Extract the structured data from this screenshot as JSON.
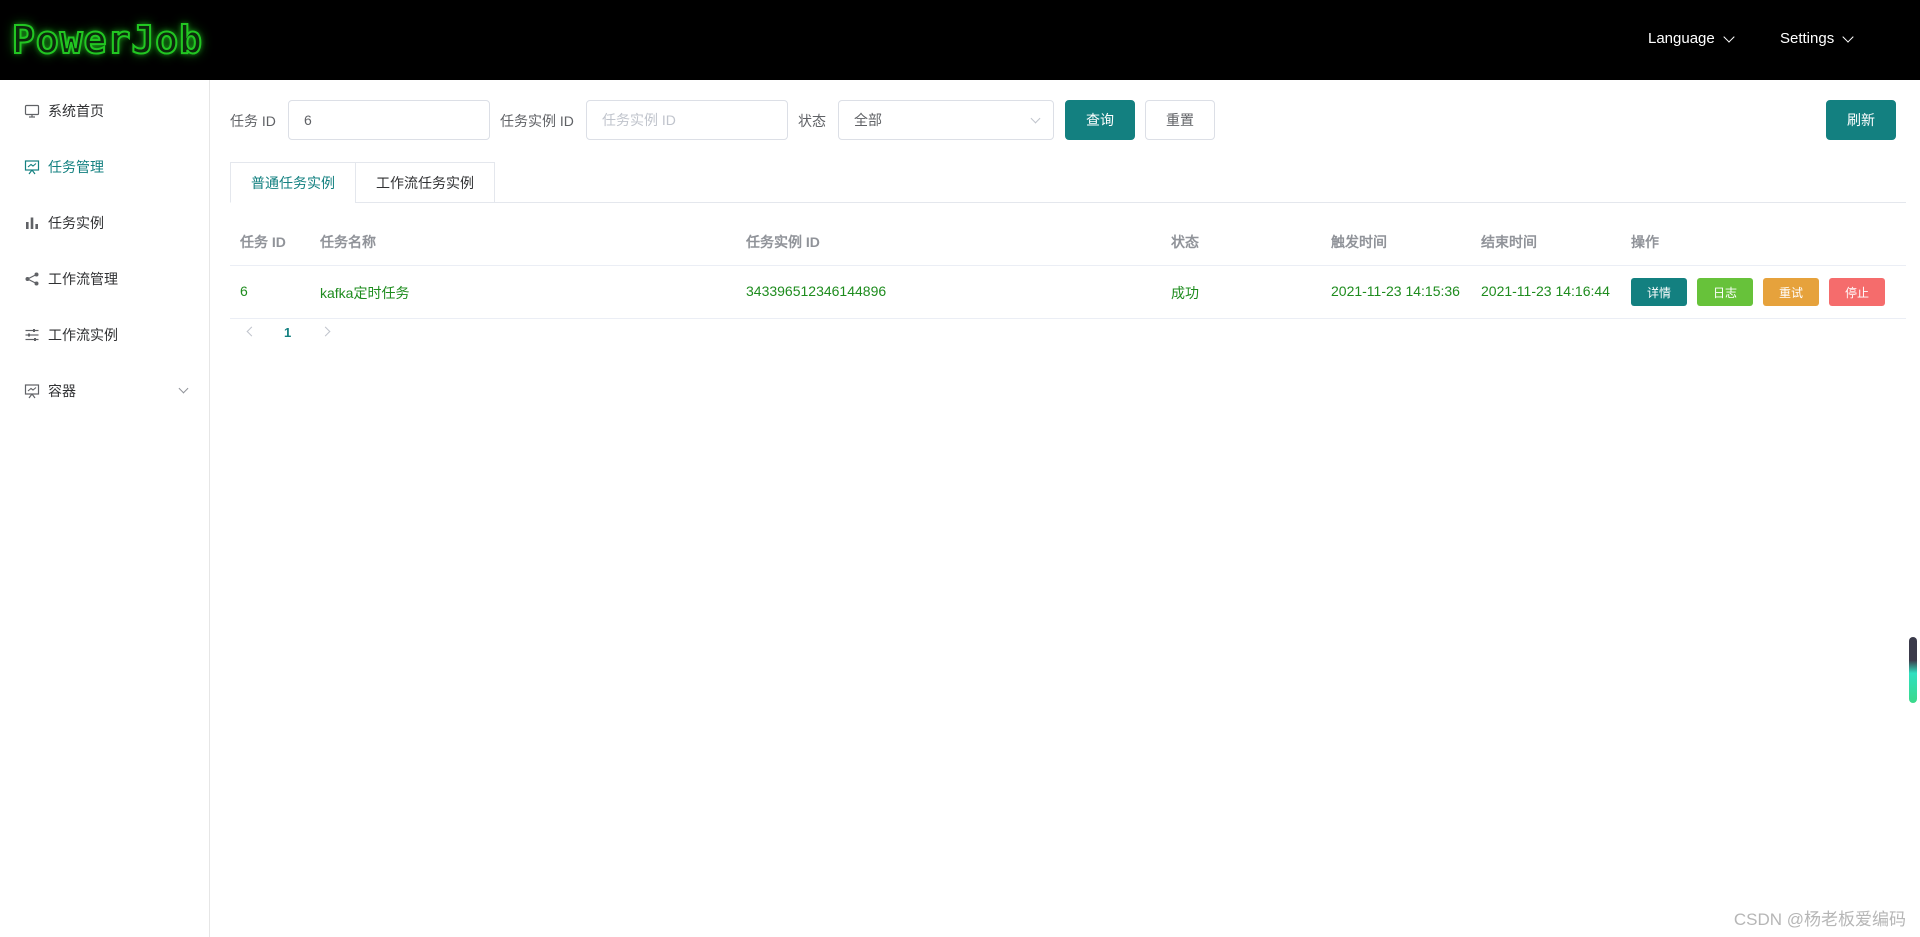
{
  "header": {
    "logo": "PowerJob",
    "language_label": "Language",
    "settings_label": "Settings"
  },
  "sidebar": {
    "items": [
      {
        "label": "系统首页",
        "icon": "monitor-icon"
      },
      {
        "label": "任务管理",
        "icon": "presentation-board-icon",
        "active": true
      },
      {
        "label": "任务实例",
        "icon": "bar-chart-icon"
      },
      {
        "label": "工作流管理",
        "icon": "share-icon"
      },
      {
        "label": "工作流实例",
        "icon": "sliders-icon"
      },
      {
        "label": "容器",
        "icon": "presentation-board-icon",
        "expandable": true
      }
    ]
  },
  "search": {
    "job_id_label": "任务 ID",
    "job_id_value": "6",
    "instance_id_label": "任务实例 ID",
    "instance_id_placeholder": "任务实例 ID",
    "status_label": "状态",
    "status_value": "全部",
    "query_button": "查询",
    "reset_button": "重置",
    "refresh_button": "刷新"
  },
  "tabs": [
    {
      "label": "普通任务实例",
      "active": true
    },
    {
      "label": "工作流任务实例",
      "active": false
    }
  ],
  "table": {
    "columns": [
      "任务 ID",
      "任务名称",
      "任务实例 ID",
      "状态",
      "触发时间",
      "结束时间",
      "操作"
    ],
    "rows": [
      {
        "job_id": "6",
        "job_name": "kafka定时任务",
        "instance_id": "343396512346144896",
        "status": "成功",
        "trigger_time": "2021-11-23 14:15:36",
        "finish_time": "2021-11-23 14:16:44",
        "actions": [
          "详情",
          "日志",
          "重试",
          "停止"
        ]
      }
    ]
  },
  "pagination": {
    "current_page": "1"
  },
  "colors": {
    "primary": "#138080",
    "success_green": "#67c23a",
    "warning_orange": "#e6a23c",
    "danger_red": "#f56c6c",
    "row_text_green": "#1e8c1e"
  },
  "watermark": "CSDN @杨老板爱编码"
}
